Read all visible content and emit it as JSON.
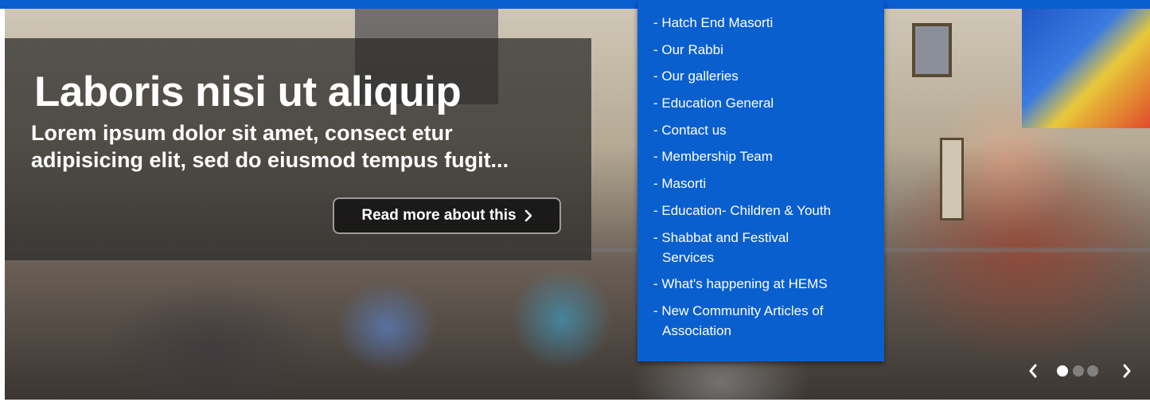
{
  "slide": {
    "title": "Laboris nisi ut aliquip",
    "body": "Lorem ipsum dolor sit amet, consect etur adipisicing elit, sed do eiusmod tempus fugit...",
    "read_more_label": "Read more about this"
  },
  "menu": {
    "items": [
      "- Hatch End Masorti",
      "- Our Rabbi",
      "- Our galleries",
      "- Education General",
      "- Contact us",
      "- Membership Team",
      "- Masorti",
      "- Education- Children & Youth",
      "- Shabbat and Festival",
      "Services",
      "- What's happening at HEMS",
      "- New Community Articles of",
      "Association"
    ]
  },
  "carousel": {
    "slide_count": 3,
    "active_slide": 1
  },
  "colors": {
    "accent_blue": "#0a5fcf",
    "caption_overlay": "#282828",
    "text": "#ffffff"
  }
}
